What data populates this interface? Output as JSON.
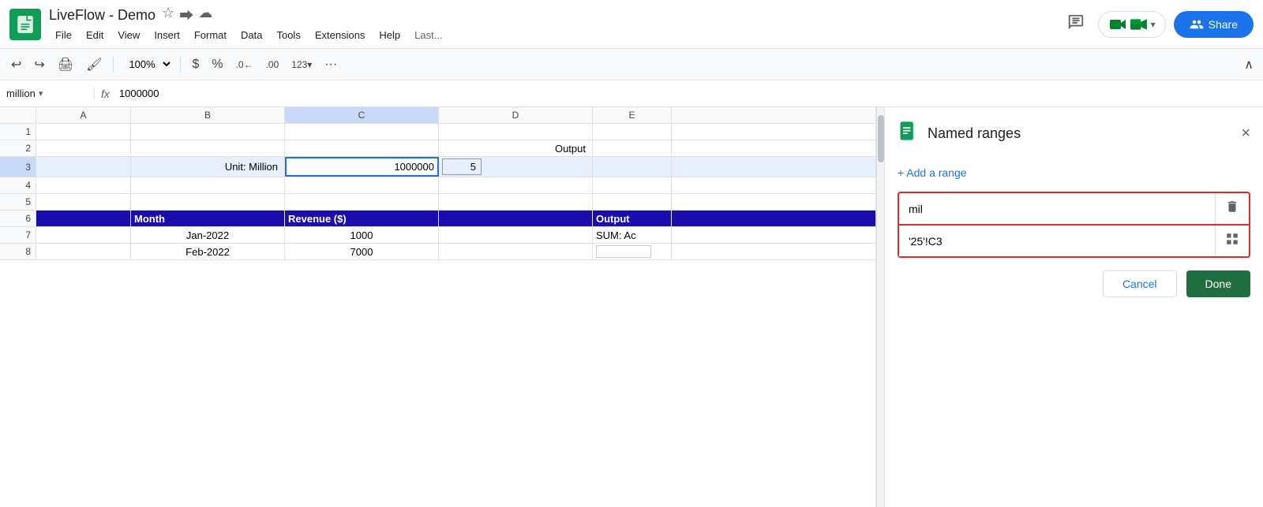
{
  "app": {
    "title": "LiveFlow - Demo",
    "icon_label": "sheets-icon"
  },
  "menu": {
    "items": [
      "File",
      "Edit",
      "View",
      "Insert",
      "Format",
      "Data",
      "Tools",
      "Extensions",
      "Help",
      "Last..."
    ]
  },
  "toolbar": {
    "zoom": "100%",
    "zoom_arrow": "▾",
    "currency": "$",
    "percent": "%",
    "decimal_less": ".0",
    "decimal_more": ".00",
    "more_formats": "123▾",
    "more_btn": "···"
  },
  "formula_bar": {
    "cell_name": "million",
    "fx_symbol": "fx",
    "value": "1000000"
  },
  "columns": [
    "A",
    "B",
    "C",
    "D",
    "E"
  ],
  "rows": [
    {
      "num": "1",
      "cells": [
        "",
        "",
        "",
        "",
        ""
      ]
    },
    {
      "num": "2",
      "cells": [
        "",
        "",
        "",
        "Output",
        ""
      ]
    },
    {
      "num": "3",
      "cells": [
        "",
        "Unit: Million",
        "1000000",
        "5",
        ""
      ]
    },
    {
      "num": "4",
      "cells": [
        "",
        "",
        "",
        "",
        ""
      ]
    },
    {
      "num": "5",
      "cells": [
        "",
        "",
        "",
        "",
        ""
      ]
    },
    {
      "num": "6",
      "cells": [
        "",
        "Month",
        "Revenue ($)",
        "",
        "Output"
      ]
    },
    {
      "num": "7",
      "cells": [
        "",
        "Jan-2022",
        "1000",
        "",
        "SUM: Ac"
      ]
    },
    {
      "num": "8",
      "cells": [
        "",
        "Feb-2022",
        "7000",
        "",
        ""
      ]
    }
  ],
  "named_ranges_panel": {
    "title": "Named ranges",
    "add_range_label": "+ Add a range",
    "name_input_value": "mil",
    "name_input_placeholder": "",
    "cell_ref_value": "'25'!C3",
    "cell_ref_placeholder": "",
    "cancel_label": "Cancel",
    "done_label": "Done",
    "delete_icon": "🗑",
    "grid_icon": "⊞",
    "close_icon": "×"
  },
  "share_button": {
    "label": "Share"
  }
}
